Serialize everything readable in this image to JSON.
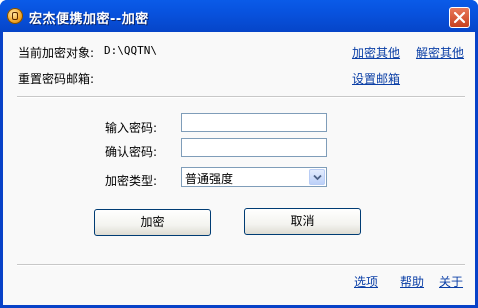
{
  "window": {
    "title": "宏杰便携加密--加密"
  },
  "header": {
    "target_label": "当前加密对象:",
    "target_path": "D:\\QQTN\\",
    "encrypt_other_link": "加密其他",
    "decrypt_other_link": "解密其他",
    "reset_email_label": "重置密码邮箱:",
    "set_email_link": "设置邮箱"
  },
  "form": {
    "password_label": "输入密码:",
    "password_value": "",
    "confirm_label": "确认密码:",
    "confirm_value": "",
    "type_label": "加密类型:",
    "type_selected": "普通强度"
  },
  "actions": {
    "encrypt_button": "加密",
    "cancel_button": "取消"
  },
  "footer": {
    "options_link": "选项",
    "help_link": "帮助",
    "about_link": "关于"
  },
  "colors": {
    "titlebar": "#0852de",
    "link": "#0b3fa6",
    "close": "#c8401e"
  }
}
